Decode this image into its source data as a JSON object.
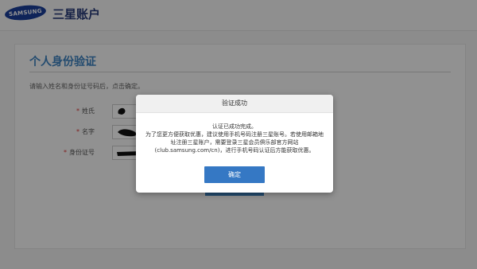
{
  "header": {
    "logo_text": "SAMSUNG",
    "app_title": "三星账户"
  },
  "form": {
    "title": "个人身份验证",
    "instructions": "请输入姓名和身份证号码后，点击确定。",
    "fields": [
      {
        "required_mark": "*",
        "label": "姓氏"
      },
      {
        "required_mark": "*",
        "label": "名字"
      },
      {
        "required_mark": "*",
        "label": "身份证号"
      }
    ]
  },
  "dialog": {
    "title": "验证成功",
    "message_lines": [
      "认证已成功完成。",
      "为了您更方便获取优惠，建议使用手机号码注册三星账号。若使用邮箱地",
      "址注册三星账户，需要登录三星会员俱乐部官方网站",
      "(club.samsung.com/cn)，进行手机号码认证后方能获取优惠。"
    ],
    "ok_label": "确定"
  },
  "colors": {
    "accent": "#3578c4",
    "brand": "#1a3f9a",
    "title_blue": "#3d82c0"
  }
}
